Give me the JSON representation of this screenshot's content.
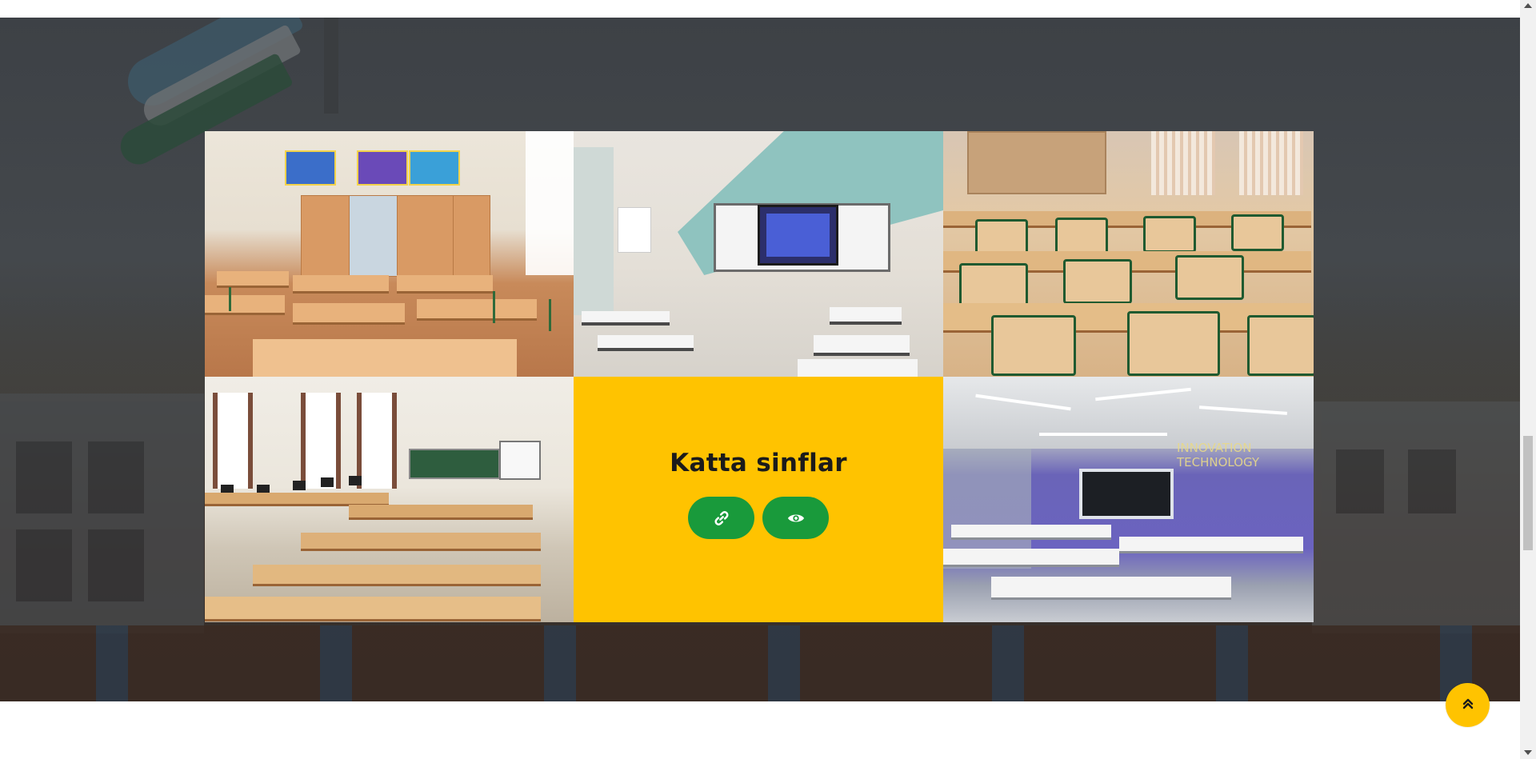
{
  "gallery": {
    "panel_title": "Katta sinflar",
    "link_button_icon": "link-icon",
    "view_button_icon": "eye-icon",
    "images": [
      {
        "name": "classroom-photo-1"
      },
      {
        "name": "classroom-photo-2"
      },
      {
        "name": "classroom-photo-3"
      },
      {
        "name": "classroom-photo-4"
      },
      {
        "name": "classroom-photo-6"
      }
    ],
    "photo_caption_text": "INNOVATION\nTECHNOLOGY"
  },
  "back_to_top": {
    "icon": "double-chevron-up-icon"
  },
  "colors": {
    "accent_yellow": "#ffc300",
    "button_green": "#199a3b",
    "title_text": "#1b1b1b",
    "section_bg_dark": "#3d4146"
  }
}
